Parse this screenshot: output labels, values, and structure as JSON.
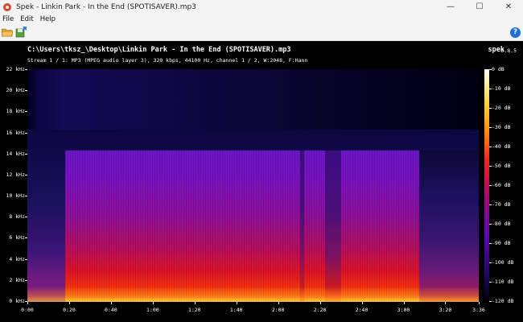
{
  "window": {
    "title": "Spek - Linkin Park - In the End (SPOTISAVER).mp3",
    "controls": {
      "minimize": "—",
      "maximize": "☐",
      "close": "✕"
    }
  },
  "menu": {
    "items": [
      "File",
      "Edit",
      "Help"
    ]
  },
  "toolbar": {
    "help_symbol": "?"
  },
  "spectrogram": {
    "file_path": "C:\\Users\\tksz_\\Desktop\\Linkin Park - In the End (SPOTISAVER).mp3",
    "stream_info": "Stream 1 / 1: MP3 (MPEG audio layer 3), 320 kbps, 44100 Hz, channel 1 / 2, W:2048, F:Hann",
    "app_name": "spek",
    "app_version": "0.8.5",
    "y_axis_labels": [
      "22 kHz",
      "20 kHz",
      "18 kHz",
      "16 kHz",
      "14 kHz",
      "12 kHz",
      "10 kHz",
      "8 kHz",
      "6 kHz",
      "4 kHz",
      "2 kHz",
      "0 kHz"
    ],
    "x_axis_labels": [
      "0:00",
      "0:20",
      "0:40",
      "1:00",
      "1:20",
      "1:40",
      "2:00",
      "2:20",
      "2:40",
      "3:00",
      "3:20",
      "3:36"
    ],
    "db_labels": [
      "0 dB",
      "-10 dB",
      "-20 dB",
      "-30 dB",
      "-40 dB",
      "-50 dB",
      "-60 dB",
      "-70 dB",
      "-80 dB",
      "-90 dB",
      "-100 dB",
      "-110 dB",
      "-120 dB"
    ],
    "duration_seconds": 216,
    "max_frequency_khz": 22,
    "cutoff_frequency_khz": 17
  }
}
